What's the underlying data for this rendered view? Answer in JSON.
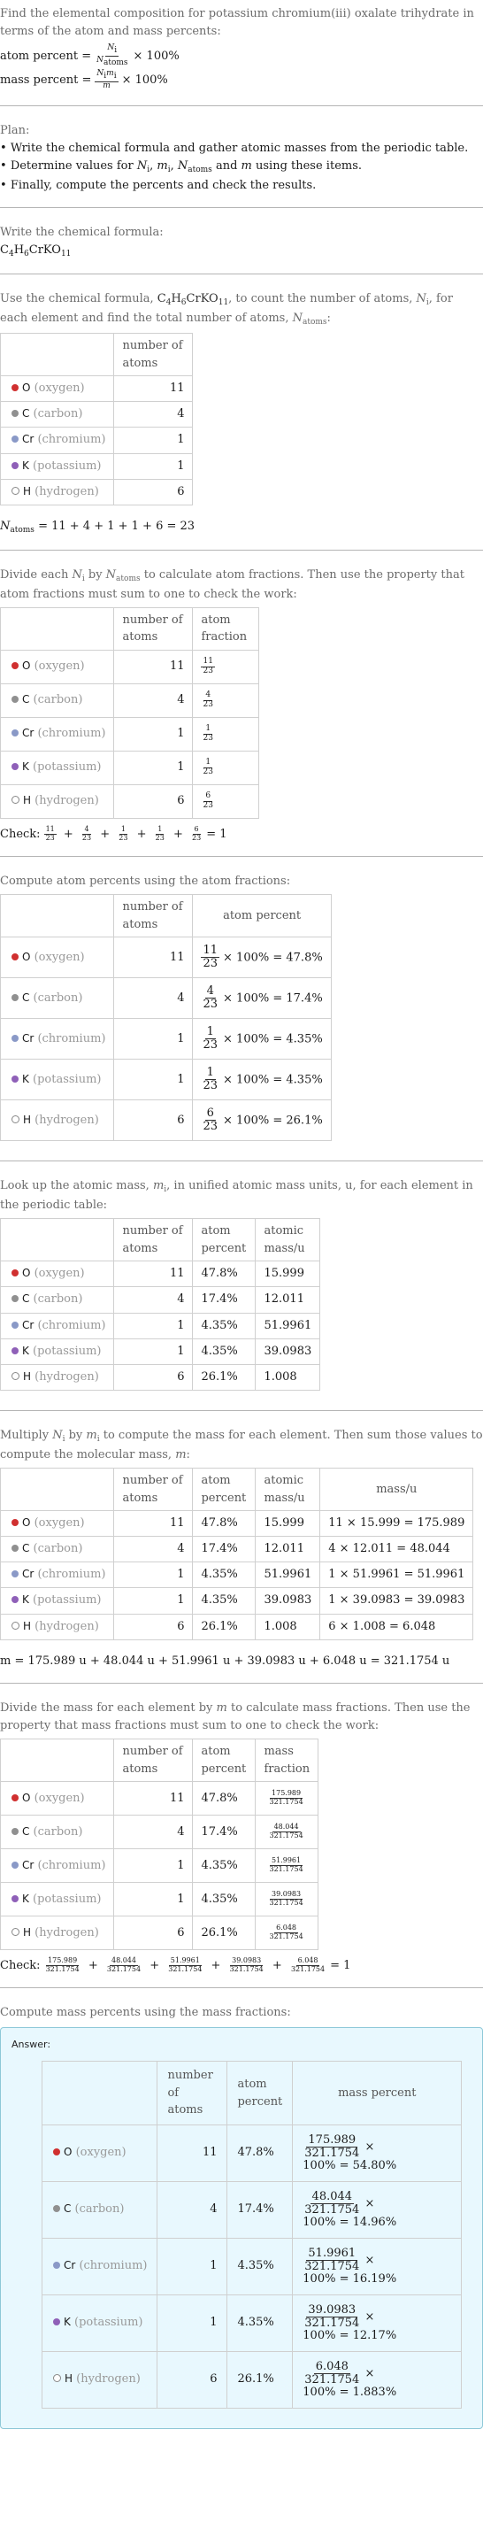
{
  "header": {
    "question": "Find the elemental composition for potassium chromium(iii) oxalate trihydrate in terms of the atom and mass percents:",
    "atom_percent_label": "atom percent =",
    "atom_percent_num": "N",
    "atom_percent_num_sub": "i",
    "atom_percent_den": "N",
    "atom_percent_den_sub": "atoms",
    "times_100": "× 100%",
    "mass_percent_label": "mass percent =",
    "mass_percent_num": "N",
    "mass_percent_num_sub": "i",
    "mass_percent_num2": "m",
    "mass_percent_num2_sub": "i",
    "mass_percent_den": "m"
  },
  "plan": {
    "title": "Plan:",
    "items": [
      "Write the chemical formula and gather atomic masses from the periodic table.",
      "Determine values for N_i, m_i, N_atoms and m using these items.",
      "Finally, compute the percents and check the results."
    ],
    "item2_prefix": "Determine values for ",
    "item2_suffix": " using these items."
  },
  "formula_section": {
    "title": "Write the chemical formula:",
    "formula_parts": [
      "C",
      "4",
      "H",
      "6",
      "CrKO",
      "11"
    ]
  },
  "elements": [
    {
      "symbol": "O",
      "name": "(oxygen)",
      "color": "#d03030",
      "hollow": false,
      "count": "11",
      "atom_fraction_num": "11",
      "atom_percent": "47.8%",
      "atomic_mass": "15.999",
      "mass_expr": "11 × 15.999 = 175.989",
      "mass": "175.989",
      "mass_percent": "100% = 54.80%"
    },
    {
      "symbol": "C",
      "name": "(carbon)",
      "color": "#909090",
      "hollow": false,
      "count": "4",
      "atom_fraction_num": "4",
      "atom_percent": "17.4%",
      "atomic_mass": "12.011",
      "mass_expr": "4 × 12.011 = 48.044",
      "mass": "48.044",
      "mass_percent": "100% = 14.96%"
    },
    {
      "symbol": "Cr",
      "name": "(chromium)",
      "color": "#8a99c7",
      "hollow": false,
      "count": "1",
      "atom_fraction_num": "1",
      "atom_percent": "4.35%",
      "atomic_mass": "51.9961",
      "mass_expr": "1 × 51.9961 = 51.9961",
      "mass": "51.9961",
      "mass_percent": "100% = 16.19%"
    },
    {
      "symbol": "K",
      "name": "(potassium)",
      "color": "#8f60b8",
      "hollow": false,
      "count": "1",
      "atom_fraction_num": "1",
      "atom_percent": "4.35%",
      "atomic_mass": "39.0983",
      "mass_expr": "1 × 39.0983 = 39.0983",
      "mass": "39.0983",
      "mass_percent": "100% = 12.17%"
    },
    {
      "symbol": "H",
      "name": "(hydrogen)",
      "color": "#ffffff",
      "hollow": true,
      "count": "6",
      "atom_fraction_num": "6",
      "atom_percent": "26.1%",
      "atomic_mass": "1.008",
      "mass_expr": "6 × 1.008 = 6.048",
      "mass": "6.048",
      "mass_percent": "100% = 1.883%"
    }
  ],
  "step_count": {
    "intro_a": "Use the chemical formula, ",
    "intro_b": ", to count the number of atoms, ",
    "intro_c": ", for each element and find the total number of atoms, ",
    "intro_d": ":",
    "col_header": "number of atoms",
    "total_label": "N",
    "total_sub": "atoms",
    "total_expr": " = 11 + 4 + 1 + 1 + 6 = 23"
  },
  "step_fraction": {
    "intro_a": "Divide each ",
    "intro_b": " by ",
    "intro_c": " to calculate atom fractions. Then use the property that atom fractions must sum to one to check the work:",
    "col_headers": [
      "number of atoms",
      "atom fraction"
    ],
    "denominator": "23",
    "check_label": "Check:",
    "check_result": "= 1"
  },
  "step_atom_percent": {
    "intro": "Compute atom percents using the atom fractions:",
    "col_headers": [
      "number of atoms",
      "atom percent"
    ],
    "times_label": "× 100% ="
  },
  "step_atomic_mass": {
    "intro_a": "Look up the atomic mass, ",
    "intro_b": ", in unified atomic mass units, u, for each element in the periodic table:",
    "col_headers": [
      "number of atoms",
      "atom percent",
      "atomic mass/u"
    ]
  },
  "step_mass": {
    "intro_a": "Multiply ",
    "intro_b": " by ",
    "intro_c": " to compute the mass for each element. Then sum those values to compute the molecular mass, ",
    "intro_d": ":",
    "col_headers": [
      "number of atoms",
      "atom percent",
      "atomic mass/u",
      "mass/u"
    ],
    "total_expr": "m = 175.989 u + 48.044 u + 51.9961 u + 39.0983 u + 6.048 u = 321.1754 u"
  },
  "step_mass_fraction": {
    "intro_a": "Divide the mass for each element by ",
    "intro_b": " to calculate mass fractions. Then use the property that mass fractions must sum to one to check the work:",
    "col_headers": [
      "number of atoms",
      "atom percent",
      "mass fraction"
    ],
    "denominator": "321.1754",
    "check_label": "Check:",
    "check_result": "= 1"
  },
  "step_mass_percent": {
    "intro": "Compute mass percents using the mass fractions:",
    "answer_label": "Answer:",
    "col_headers": [
      "number of atoms",
      "atom percent",
      "mass percent"
    ],
    "times": "×",
    "denominator": "321.1754"
  }
}
